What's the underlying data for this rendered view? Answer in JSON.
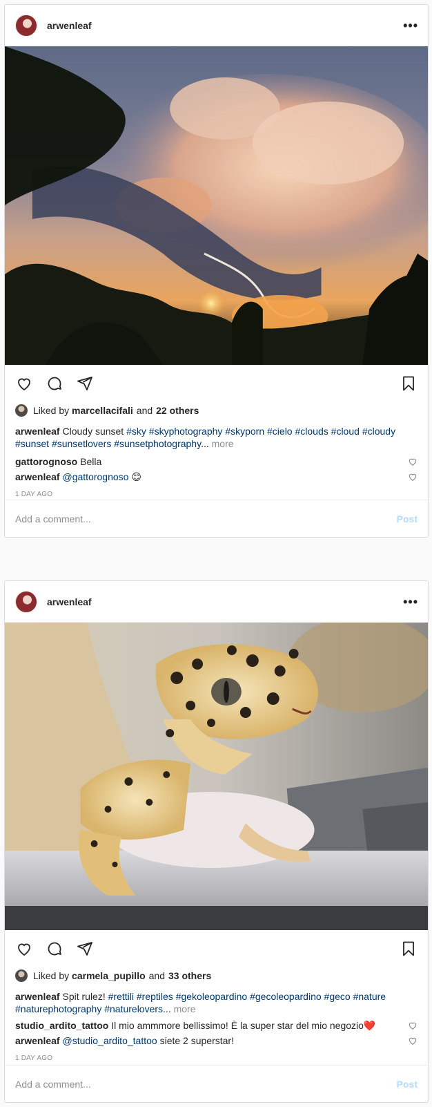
{
  "posts": [
    {
      "username": "arwenleaf",
      "liked_by_prefix": "Liked by",
      "liked_by_user": "marcellacifali",
      "liked_by_and": "and",
      "others": "22 others",
      "caption": {
        "author": "arwenleaf",
        "text": "Cloudy sunset",
        "tags": [
          "#sky",
          "#skyphotography",
          "#skyporn",
          "#cielo",
          "#clouds",
          "#cloud",
          "#cloudy",
          "#sunset",
          "#sunsetlovers",
          "#sunsetphotography"
        ],
        "ellipsis": "...",
        "more": "more"
      },
      "comments": [
        {
          "author": "gattorognoso",
          "mention": "",
          "text": "Bella"
        },
        {
          "author": "arwenleaf",
          "mention": "@gattorognoso",
          "text": "😊"
        }
      ],
      "time": "1 DAY AGO",
      "add_comment_placeholder": "Add a comment...",
      "post_button": "Post"
    },
    {
      "username": "arwenleaf",
      "liked_by_prefix": "Liked by",
      "liked_by_user": "carmela_pupillo",
      "liked_by_and": "and",
      "others": "33 others",
      "caption": {
        "author": "arwenleaf",
        "text": "Spit rulez!",
        "tags": [
          "#rettili",
          "#reptiles",
          "#gekoleopardino",
          "#gecoleopardino",
          "#geco",
          "#nature",
          "#naturephotography",
          "#naturelovers"
        ],
        "ellipsis": "...",
        "more": "more"
      },
      "comments": [
        {
          "author": "studio_ardito_tattoo",
          "mention": "",
          "text": "Il mio ammmore bellissimo! È la super star del mio negozio❤️"
        },
        {
          "author": "arwenleaf",
          "mention": "@studio_ardito_tattoo",
          "text": "siete 2 superstar!"
        }
      ],
      "time": "1 DAY AGO",
      "add_comment_placeholder": "Add a comment...",
      "post_button": "Post"
    }
  ],
  "colors": {
    "hashtag": "#00376b",
    "muted": "#8e8e8e",
    "post_button_disabled": "#b3dbff",
    "border": "#dbdbdb"
  },
  "icons": [
    "heart-icon",
    "comment-icon",
    "share-icon",
    "bookmark-icon",
    "more-options-icon"
  ]
}
